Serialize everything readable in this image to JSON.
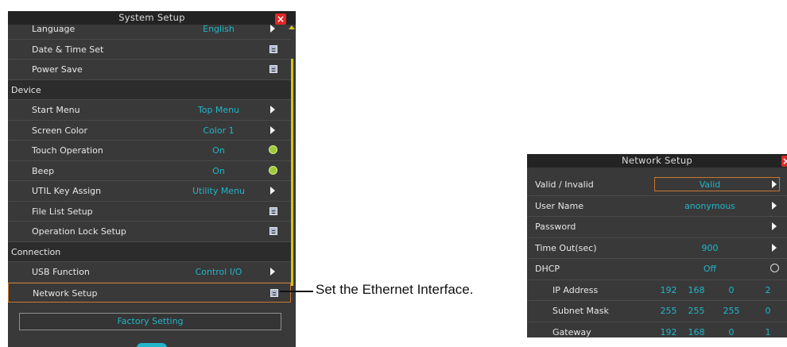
{
  "system_setup": {
    "title": "System Setup",
    "close_label": "×",
    "rows": [
      {
        "label": "Language",
        "value": "English",
        "control": "arrow"
      },
      {
        "label": "Date & Time Set",
        "value": "",
        "control": "open"
      },
      {
        "label": "Power Save",
        "value": "",
        "control": "open"
      },
      {
        "label": "Device",
        "value": "",
        "control": "section"
      },
      {
        "label": "Start Menu",
        "value": "Top Menu",
        "control": "arrow"
      },
      {
        "label": "Screen Color",
        "value": "Color 1",
        "control": "arrow"
      },
      {
        "label": "Touch Operation",
        "value": "On",
        "control": "toggle"
      },
      {
        "label": "Beep",
        "value": "On",
        "control": "toggle"
      },
      {
        "label": "UTIL Key Assign",
        "value": "Utility Menu",
        "control": "arrow"
      },
      {
        "label": "File List Setup",
        "value": "",
        "control": "open"
      },
      {
        "label": "Operation Lock Setup",
        "value": "",
        "control": "open"
      },
      {
        "label": "Connection",
        "value": "",
        "control": "section"
      },
      {
        "label": "USB Function",
        "value": "Control I/O",
        "control": "arrow"
      },
      {
        "label": "Network Setup",
        "value": "",
        "control": "open",
        "highlighted": true
      }
    ],
    "factory_button": "Factory Setting"
  },
  "callout": {
    "text": "Set the Ethernet Interface."
  },
  "network_setup": {
    "title": "Network Setup",
    "close_label": "×",
    "valid_invalid": {
      "label": "Valid / Invalid",
      "value": "Valid"
    },
    "user_name": {
      "label": "User Name",
      "value": "anonymous"
    },
    "password": {
      "label": "Password"
    },
    "timeout": {
      "label": "Time Out(sec)",
      "value": "900"
    },
    "dhcp": {
      "label": "DHCP",
      "value": "Off"
    },
    "ip_address": {
      "label": "IP Address",
      "octets": [
        "192",
        "168",
        "0",
        "2"
      ]
    },
    "subnet_mask": {
      "label": "Subnet Mask",
      "octets": [
        "255",
        "255",
        "255",
        "0"
      ]
    },
    "gateway": {
      "label": "Gateway",
      "octets": [
        "192",
        "168",
        "0",
        "1"
      ]
    }
  },
  "colors": {
    "panel_bg": "#393939",
    "title_bg": "#232323",
    "value_text": "#21b6c9",
    "highlight_border": "#c97730",
    "scrollbar": "#d4c31c",
    "close_button": "#e32626"
  }
}
